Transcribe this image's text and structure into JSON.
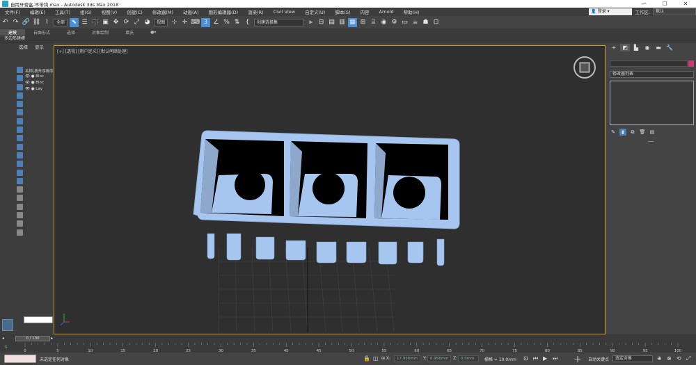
{
  "window": {
    "title": "自用牙膏盒-不带钩.max - Autodesk 3ds Max 2018",
    "controls": [
      "—",
      "☐",
      "✕"
    ]
  },
  "menubar": {
    "items": [
      "文件(F)",
      "编辑(E)",
      "工具(T)",
      "组(G)",
      "视图(V)",
      "创建(C)",
      "修改器(M)",
      "动画(A)",
      "图形编辑器(D)",
      "渲染(R)",
      "Civil View",
      "自定义(U)",
      "脚本(S)",
      "内容",
      "Arnold",
      "帮助(H)"
    ],
    "login": "登录",
    "workspace_label": "工作区:",
    "workspace_value": "默认"
  },
  "toolbar": {
    "selection_filter": "全部",
    "ref_coord": "视图",
    "named_sel": "创建选择集",
    "snap_value": "3"
  },
  "ribbon": {
    "tabs": [
      "建模",
      "自由形式",
      "选择",
      "对象绘制",
      "填充"
    ],
    "active": "建模",
    "panel_label": "多边形建模"
  },
  "scene_explorer": {
    "tabs": [
      "选择",
      "显示"
    ],
    "header": "名称(按升序排序)",
    "items": [
      "Bloc",
      "Bloc",
      "Lay"
    ]
  },
  "viewport": {
    "label": "[+] [透视] [用户定义] [默认明暗处理]",
    "object_color": "#a7c6ef",
    "border_color": "#c8a02a"
  },
  "command_panel": {
    "modifier_list": "修改器列表"
  },
  "timeslider": {
    "frame_display": "0 / 100",
    "start": 0,
    "end": 100,
    "ticks": [
      "0",
      "5",
      "10",
      "15",
      "20",
      "25",
      "30",
      "35",
      "40",
      "45",
      "50",
      "55",
      "60",
      "65",
      "70",
      "75",
      "80",
      "85",
      "90",
      "95",
      "100"
    ]
  },
  "status": {
    "message": "未选定任何对象",
    "x_value": "17.956mm",
    "y_value": "6.956mm",
    "z_value": "0.0mm",
    "grid_label": "栅格 = 10.0mm",
    "auto_key": "自动关键点",
    "set_key_filter": "选定对象"
  }
}
